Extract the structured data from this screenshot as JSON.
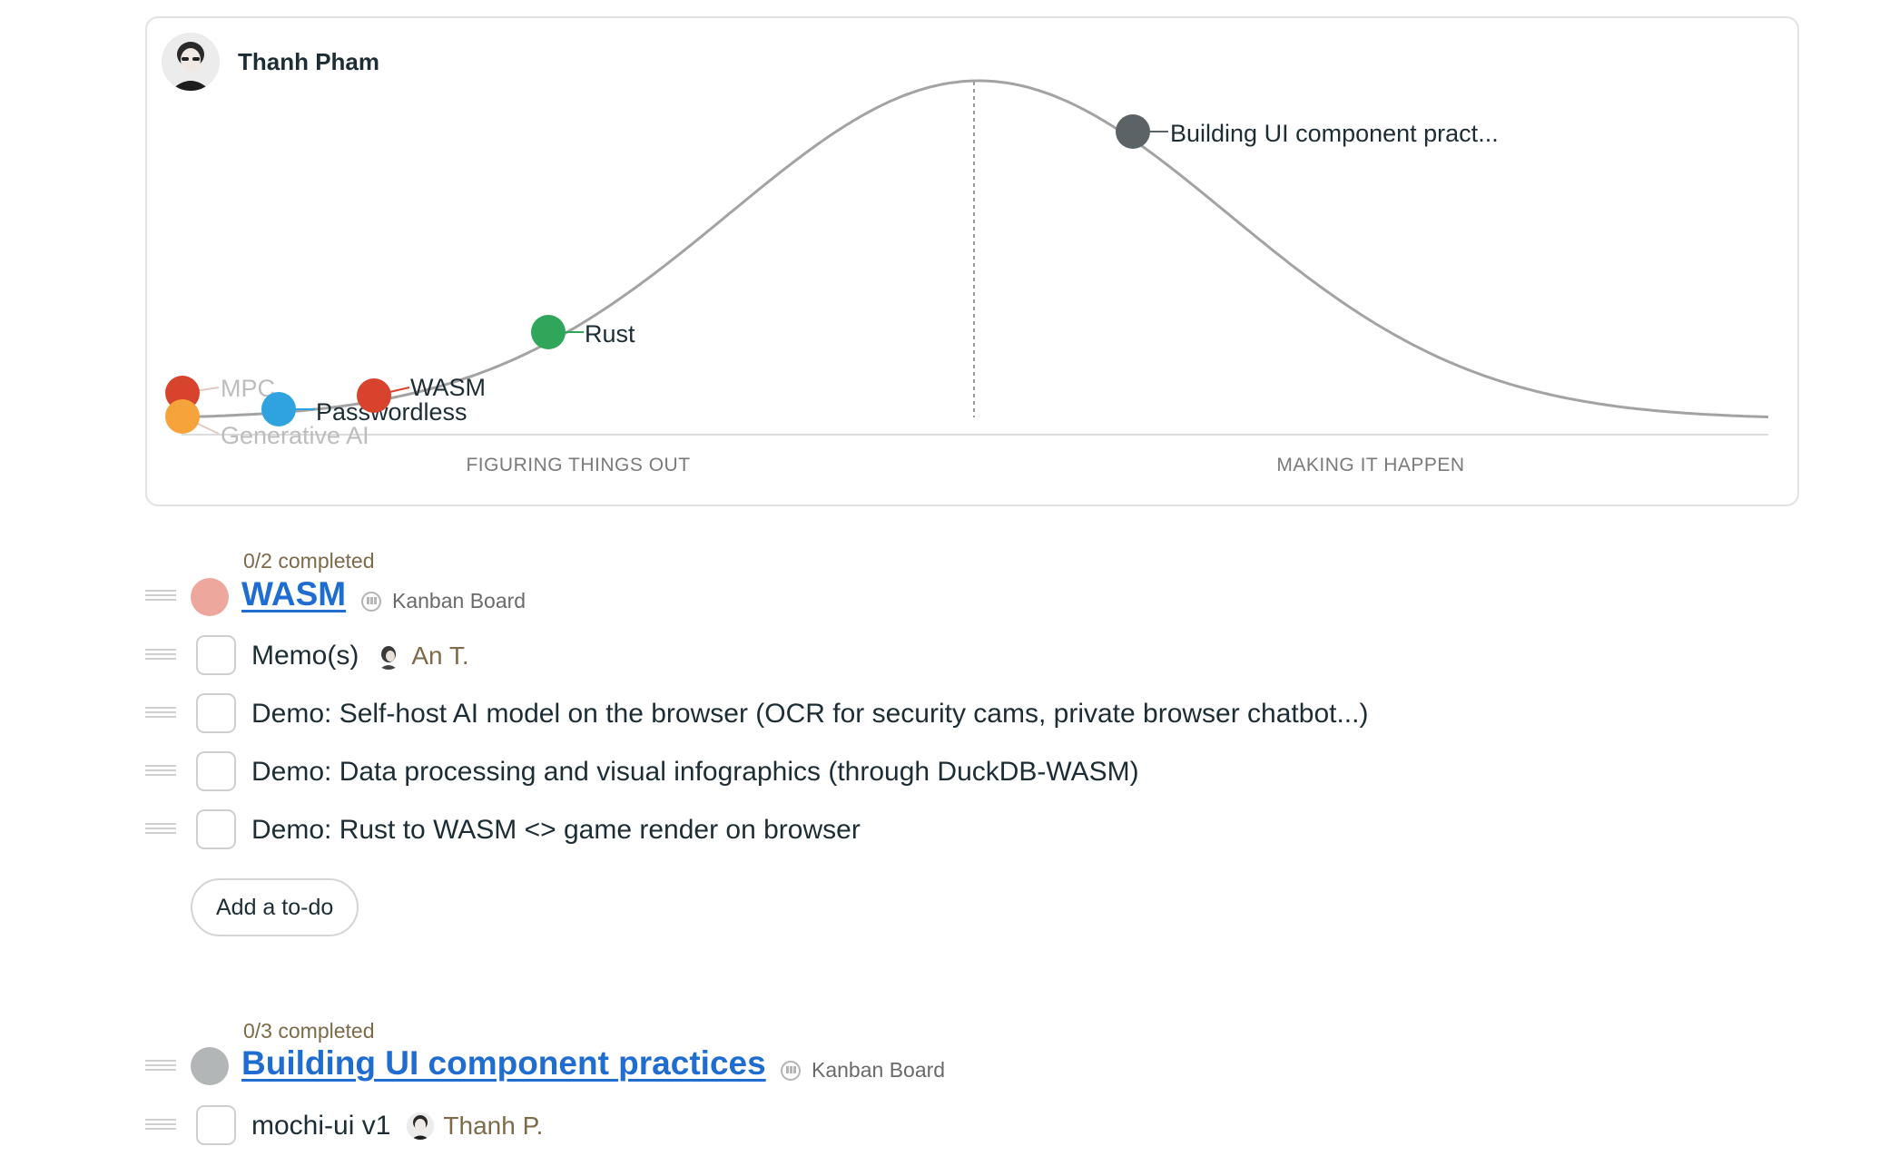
{
  "hill_chart": {
    "owner": "Thanh Pham",
    "phase_labels": {
      "left": "FIGURING THINGS OUT",
      "right": "MAKING IT HAPPEN"
    },
    "points": [
      {
        "label": "MPC",
        "color": "#d8432e",
        "label_faded": true
      },
      {
        "label": "Generative AI",
        "color": "#f5a33a",
        "label_faded": true
      },
      {
        "label": "Passwordless",
        "color": "#2fa3e0",
        "label_faded": false
      },
      {
        "label": "WASM",
        "color": "#d8432e",
        "label_faded": false
      },
      {
        "label": "Rust",
        "color": "#2fa65a",
        "label_faded": false
      },
      {
        "label": "Building UI component pract...",
        "color": "#5c6367",
        "label_faded": false
      }
    ]
  },
  "groups": [
    {
      "progress": "0/2 completed",
      "title": "WASM",
      "dot_color": "#eea79c",
      "board": "Kanban Board",
      "todos": [
        {
          "text": "Memo(s)",
          "assignee": "An T."
        },
        {
          "text": "Demo: Self-host AI model on the browser (OCR for security cams, private browser chatbot...)",
          "assignee": ""
        },
        {
          "text": "Demo: Data processing and visual infographics (through DuckDB-WASM)",
          "assignee": ""
        },
        {
          "text": "Demo: Rust to WASM <> game render on browser",
          "assignee": ""
        }
      ],
      "add_label": "Add a to-do"
    },
    {
      "progress": "0/3 completed",
      "title": "Building UI component practices",
      "dot_color": "#b3b6b7",
      "board": "Kanban Board",
      "todos": [
        {
          "text": "mochi-ui v1",
          "assignee": "Thanh P."
        }
      ]
    }
  ]
}
